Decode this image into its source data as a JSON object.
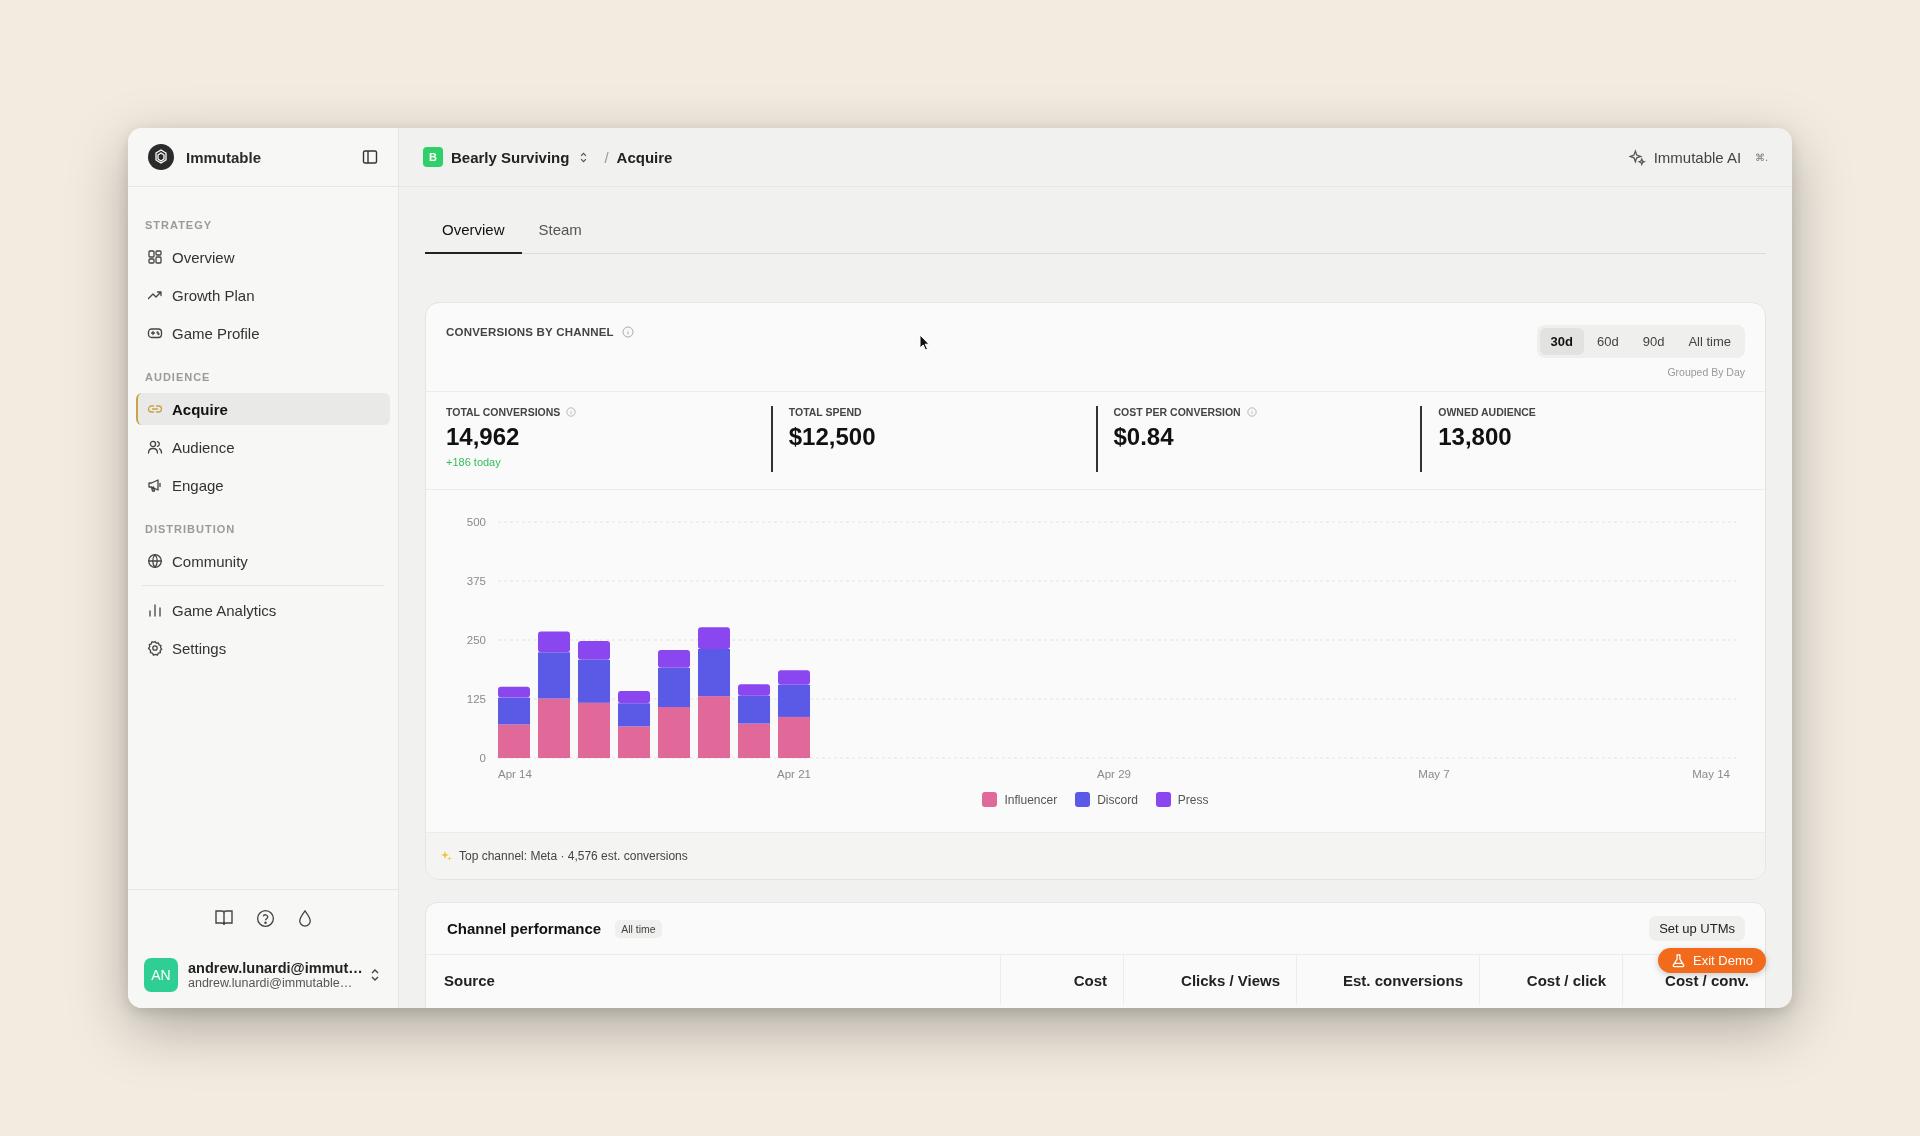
{
  "sidebar": {
    "brand": "Immutable",
    "sections": [
      {
        "title": "STRATEGY",
        "items": [
          {
            "label": "Overview",
            "selected": false
          },
          {
            "label": "Growth Plan",
            "selected": false
          },
          {
            "label": "Game Profile",
            "selected": false
          }
        ]
      },
      {
        "title": "AUDIENCE",
        "items": [
          {
            "label": "Acquire",
            "selected": true
          },
          {
            "label": "Audience",
            "selected": false
          },
          {
            "label": "Engage",
            "selected": false
          }
        ]
      },
      {
        "title": "DISTRIBUTION",
        "items": [
          {
            "label": "Community",
            "selected": false
          }
        ]
      },
      {
        "items": [
          {
            "label": "Game Analytics",
            "selected": false
          },
          {
            "label": "Settings",
            "selected": false
          }
        ]
      }
    ],
    "user": {
      "initials": "AN",
      "name": "andrew.lunardi@immut…",
      "email": "andrew.lunardi@immutable…"
    }
  },
  "header": {
    "project_badge": "B",
    "project": "Bearly Surviving",
    "separator": "/",
    "page": "Acquire",
    "ai_button": "Immutable AI",
    "shortcut": "⌘."
  },
  "tabs": [
    {
      "label": "Overview",
      "selected": true
    },
    {
      "label": "Steam",
      "selected": false
    }
  ],
  "conversions_card": {
    "title": "CONVERSIONS BY CHANNEL",
    "ranges": [
      {
        "label": "30d",
        "selected": true
      },
      {
        "label": "60d",
        "selected": false
      },
      {
        "label": "90d",
        "selected": false
      },
      {
        "label": "All time",
        "selected": false
      }
    ],
    "grouping": "Grouped By Day",
    "stats": [
      {
        "label": "TOTAL CONVERSIONS",
        "info": true,
        "value": "14,962",
        "delta": "+186 today"
      },
      {
        "label": "TOTAL SPEND",
        "info": false,
        "value": "$12,500"
      },
      {
        "label": "COST PER CONVERSION",
        "info": true,
        "value": "$0.84"
      },
      {
        "label": "OWNED AUDIENCE",
        "info": false,
        "value": "13,800"
      }
    ],
    "chart_data": {
      "type": "bar",
      "stacked": true,
      "grid": true,
      "categories": [
        "Apr 14",
        null,
        null,
        null,
        null,
        null,
        null,
        "Apr 21",
        null,
        null,
        null,
        null,
        null,
        null,
        null,
        "Apr 29",
        null,
        null,
        null,
        null,
        null,
        null,
        null,
        "May 7",
        null,
        null,
        null,
        null,
        null,
        null,
        "May 14"
      ],
      "series": [
        {
          "name": "Influencer",
          "color": "#e0699a",
          "values": [
            71,
            126,
            117,
            67,
            108,
            131,
            73,
            87,
            null,
            null,
            null,
            null,
            null,
            null,
            null,
            null,
            null,
            null,
            null,
            null,
            null,
            null,
            null,
            null,
            null,
            null,
            null,
            null,
            null,
            null,
            null
          ]
        },
        {
          "name": "Discord",
          "color": "#5a5ae6",
          "values": [
            57,
            98,
            91,
            49,
            83,
            100,
            59,
            68,
            null,
            null,
            null,
            null,
            null,
            null,
            null,
            null,
            null,
            null,
            null,
            null,
            null,
            null,
            null,
            null,
            null,
            null,
            null,
            null,
            null,
            null,
            null
          ]
        },
        {
          "name": "Press",
          "color": "#8a46ef",
          "values": [
            23,
            44,
            40,
            26,
            38,
            46,
            24,
            31,
            null,
            null,
            null,
            null,
            null,
            null,
            null,
            null,
            null,
            null,
            null,
            null,
            null,
            null,
            null,
            null,
            null,
            null,
            null,
            null,
            null,
            null,
            null
          ]
        }
      ],
      "ylim": [
        0,
        500
      ],
      "yticks": [
        0,
        125,
        250,
        375,
        500
      ]
    },
    "footer": "Top channel: Meta · 4,576 est. conversions"
  },
  "performance_card": {
    "title": "Channel performance",
    "badge": "All time",
    "button": "Set up UTMs",
    "columns": [
      "Source",
      "Cost",
      "Clicks / Views",
      "Est. conversions",
      "Cost / click",
      "Cost / conv."
    ]
  },
  "exit_button": "Exit Demo"
}
